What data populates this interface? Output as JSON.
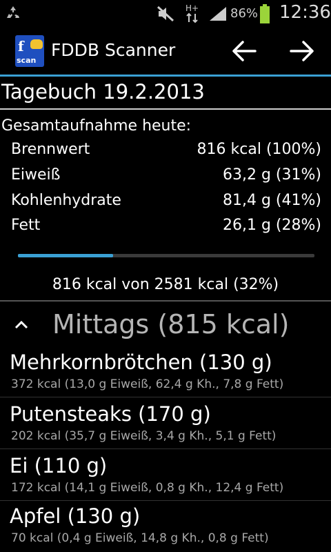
{
  "status_bar": {
    "battery_percent": "86%",
    "time": "12:36",
    "network_type": "H+",
    "icons": [
      "recycle-icon",
      "mute-icon",
      "hplus-data-icon",
      "signal-icon",
      "battery-icon"
    ]
  },
  "action_bar": {
    "app_title": "FDDB Scanner",
    "logo_text_main": "f",
    "logo_text_sub": "scan",
    "back_icon": "arrow-left-icon",
    "forward_icon": "arrow-right-icon",
    "accent_color": "#3aa0d4"
  },
  "diary": {
    "title": "Tagebuch 19.2.2013"
  },
  "summary": {
    "heading": "Gesamtaufnahme heute:",
    "rows": [
      {
        "label": "Brennwert",
        "value": "816 kcal (100%)"
      },
      {
        "label": "Eiweiß",
        "value": "63,2 g (31%)"
      },
      {
        "label": "Kohlenhydrate",
        "value": "81,4 g (41%)"
      },
      {
        "label": "Fett",
        "value": "26,1 g (28%)"
      }
    ],
    "progress_fraction": 0.32,
    "total_line": "816 kcal von 2581 kcal (32%)"
  },
  "meal": {
    "title": "Mittags (815 kcal)",
    "collapse_icon": "chevron-up-icon",
    "items": [
      {
        "name": "Mehrkornbrötchen (130 g)",
        "detail": "372 kcal (13,0 g Eiweiß, 62,4 g Kh., 7,8 g Fett)"
      },
      {
        "name": "Putensteaks (170 g)",
        "detail": "202 kcal (35,7 g Eiweiß, 3,4 g Kh., 5,1 g Fett)"
      },
      {
        "name": "Ei (110 g)",
        "detail": "172 kcal (14,1 g Eiweiß, 0,8 g Kh., 12,4 g Fett)"
      },
      {
        "name": "Apfel (130 g)",
        "detail": "70 kcal (0,4 g Eiweiß, 14,8 g Kh., 0,8 g Fett)"
      }
    ]
  }
}
